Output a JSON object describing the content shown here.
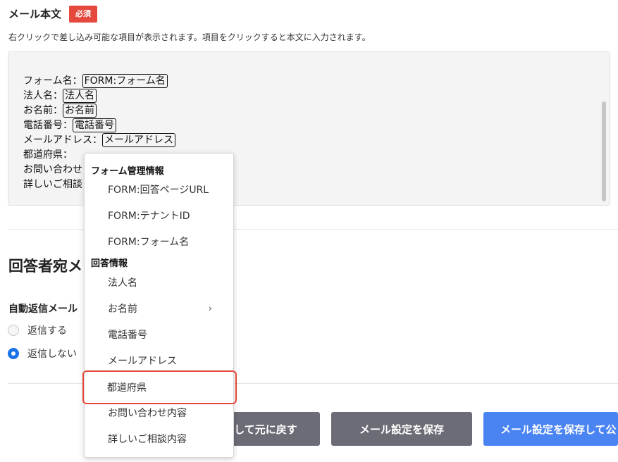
{
  "section": {
    "title": "メール本文",
    "required_badge": "必須",
    "hint": "右クリックで差し込み可能な項目が表示されます。項目をクリックすると本文に入力されます。"
  },
  "editor": {
    "lines": [
      {
        "label": "フォーム名：",
        "tag": "FORM:フォーム名"
      },
      {
        "label": "法人名：",
        "tag": "法人名"
      },
      {
        "label": "お名前：",
        "tag": "お名前"
      },
      {
        "label": "電話番号：",
        "tag": "電話番号"
      },
      {
        "label": "メールアドレス：",
        "tag": "メールアドレス"
      },
      {
        "label": "都道府県：",
        "tag": ""
      },
      {
        "label": "お問い合わせ",
        "tag": ""
      },
      {
        "label": "詳しいご相談",
        "tag": ""
      }
    ]
  },
  "respondent": {
    "heading": "回答者宛メ",
    "auto_reply_label": "自動返信メール",
    "options": [
      {
        "label": "返信する",
        "selected": false
      },
      {
        "label": "返信しない",
        "selected": true
      }
    ]
  },
  "buttons": {
    "revert": "して元に戻す",
    "save": "メール設定を保存",
    "save_publish": "メール設定を保存して公"
  },
  "context_menu": {
    "group1": "フォーム管理情報",
    "group1_items": [
      "FORM:回答ページURL",
      "FORM:テナントID",
      "FORM:フォーム名"
    ],
    "group2": "回答情報",
    "group2_items": [
      "法人名",
      "お名前",
      "電話番号",
      "メールアドレス",
      "都道府県",
      "お問い合わせ内容",
      "詳しいご相談内容"
    ],
    "submenu_item": "お名前",
    "highlighted_item": "都道府県"
  },
  "colors": {
    "badge": "#e5483c",
    "primary": "#4a84f2",
    "secondary": "#6c6c77",
    "radio_selected": "#1a73e8"
  }
}
